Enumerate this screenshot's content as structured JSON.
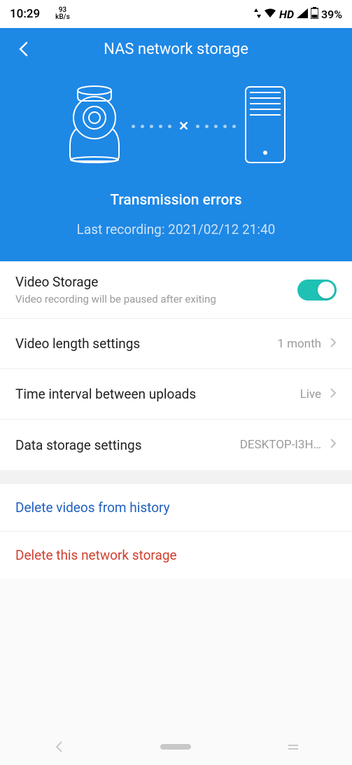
{
  "status_bar": {
    "time": "10:29",
    "net_speed_top": "93",
    "net_speed_bottom": "kB/s",
    "hd_label": "HD",
    "battery": "39%"
  },
  "header": {
    "title": "NAS network storage",
    "status_message": "Transmission errors",
    "last_recording_prefix": "Last recording: ",
    "last_recording_value": "2021/02/12 21:40"
  },
  "settings": {
    "video_storage": {
      "title": "Video Storage",
      "subtitle": "Video recording will be paused after exiting",
      "enabled": true
    },
    "video_length": {
      "title": "Video length settings",
      "value": "1 month"
    },
    "time_interval": {
      "title": "Time interval between uploads",
      "value": "Live"
    },
    "data_storage": {
      "title": "Data storage settings",
      "value": "DESKTOP-I3H…"
    }
  },
  "actions": {
    "delete_history": "Delete videos from history",
    "delete_storage": "Delete this network storage"
  }
}
